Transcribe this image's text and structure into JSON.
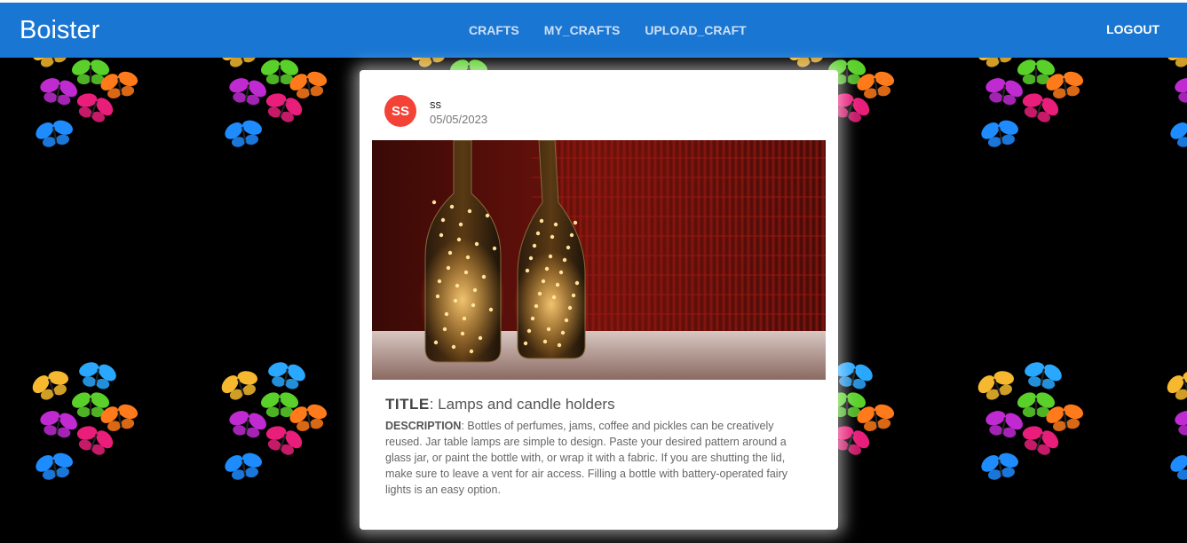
{
  "header": {
    "brand": "Boister",
    "nav": [
      "CRAFTS",
      "MY_CRAFTS",
      "UPLOAD_CRAFT"
    ],
    "logout": "LOGOUT",
    "color": "#1976d2"
  },
  "background": {
    "pattern": "colorful-butterflies",
    "color": "#000000"
  },
  "post": {
    "avatar_initials": "SS",
    "avatar_color": "#f44336",
    "username": "ss",
    "date": "05/05/2023",
    "image_icon": "bottle-lamps-photo",
    "title_label": "TITLE",
    "title": "Lamps and candle holders",
    "description_label": "DESCRIPTION",
    "description": "Bottles of perfumes, jams, coffee and pickles can be creatively reused. Jar table lamps are simple to design. Paste your desired pattern around a glass jar, or paint the bottle with, or wrap it with a fabric. If you are shutting the lid, make sure to leave a vent for air access. Filling a bottle with battery-operated fairy lights is an easy option."
  }
}
